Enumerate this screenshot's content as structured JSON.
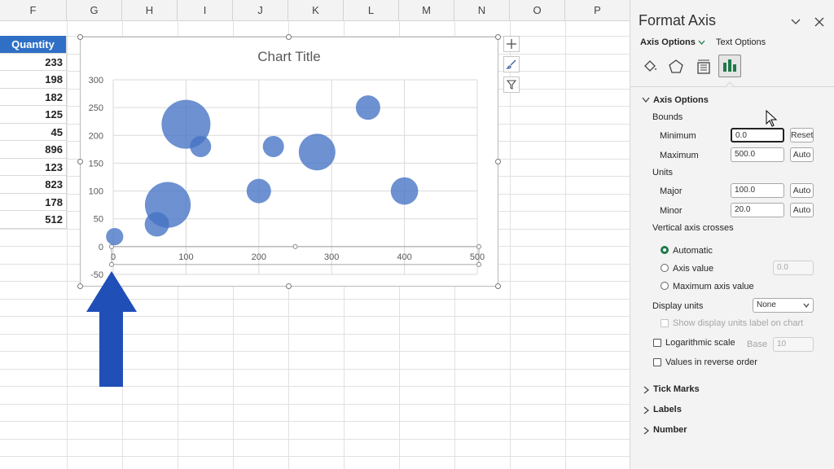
{
  "sheet": {
    "columns": [
      "F",
      "G",
      "H",
      "I",
      "J",
      "K",
      "L",
      "M",
      "N",
      "O",
      "P"
    ],
    "quantity_header": "Quantity",
    "quantity_values": [
      "233",
      "198",
      "182",
      "125",
      "45",
      "896",
      "123",
      "823",
      "178",
      "512"
    ]
  },
  "chart": {
    "title": "Chart Title",
    "colors": {
      "bubble": "#4472c4",
      "arrow": "#1f4fb7"
    }
  },
  "chart_data": {
    "type": "scatter",
    "subtype": "bubble",
    "title": "Chart Title",
    "xlim": [
      0,
      500
    ],
    "ylim": [
      -50,
      300
    ],
    "x_ticks": [
      "0",
      "100",
      "200",
      "300",
      "400",
      "500"
    ],
    "y_ticks": [
      "300",
      "250",
      "200",
      "150",
      "100",
      "50",
      "0",
      "-50"
    ],
    "grid": true,
    "points": [
      {
        "x": 2,
        "y": 18,
        "size": 1
      },
      {
        "x": 60,
        "y": 40,
        "size": 2
      },
      {
        "x": 75,
        "y": 75,
        "size": 7
      },
      {
        "x": 100,
        "y": 220,
        "size": 8
      },
      {
        "x": 120,
        "y": 180,
        "size": 1.5
      },
      {
        "x": 200,
        "y": 100,
        "size": 2
      },
      {
        "x": 220,
        "y": 180,
        "size": 1.5
      },
      {
        "x": 280,
        "y": 170,
        "size": 4.5
      },
      {
        "x": 350,
        "y": 250,
        "size": 2
      },
      {
        "x": 400,
        "y": 100,
        "size": 2.5
      }
    ]
  },
  "panel": {
    "title": "Format Axis",
    "tab_axis_options": "Axis Options",
    "tab_text_options": "Text Options",
    "section_axis_options": "Axis Options",
    "bounds_label": "Bounds",
    "minimum_label": "Minimum",
    "minimum_value": "0.0",
    "reset_label": "Reset",
    "maximum_label": "Maximum",
    "maximum_value": "500.0",
    "auto_label": "Auto",
    "units_label": "Units",
    "major_label": "Major",
    "major_value": "100.0",
    "minor_label": "Minor",
    "minor_value": "20.0",
    "vertical_crosses_label": "Vertical axis crosses",
    "automatic_label": "Automatic",
    "axis_value_label": "Axis value",
    "axis_value_value": "0.0",
    "max_axis_value_label": "Maximum axis value",
    "display_units_label": "Display units",
    "display_units_value": "None",
    "show_display_units_label": "Show display units label on chart",
    "log_scale_label": "Logarithmic scale",
    "base_label": "Base",
    "base_value": "10",
    "reverse_order_label": "Values in reverse order",
    "tick_marks_label": "Tick Marks",
    "labels_label": "Labels",
    "number_label": "Number"
  }
}
